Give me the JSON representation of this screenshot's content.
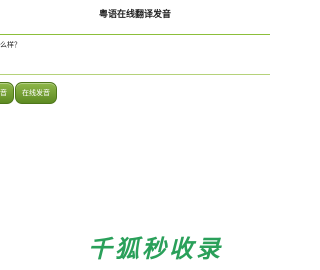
{
  "header": {
    "title": "粤语在线翻译发音"
  },
  "input": {
    "text": "么样？"
  },
  "buttons": {
    "left_label": "音",
    "right_label": "在线发音"
  },
  "watermark": {
    "text": "千狐秒收录"
  },
  "colors": {
    "accent": "#6f9a2c",
    "divider": "#8cbf3a",
    "watermark": "#2aa05a"
  }
}
